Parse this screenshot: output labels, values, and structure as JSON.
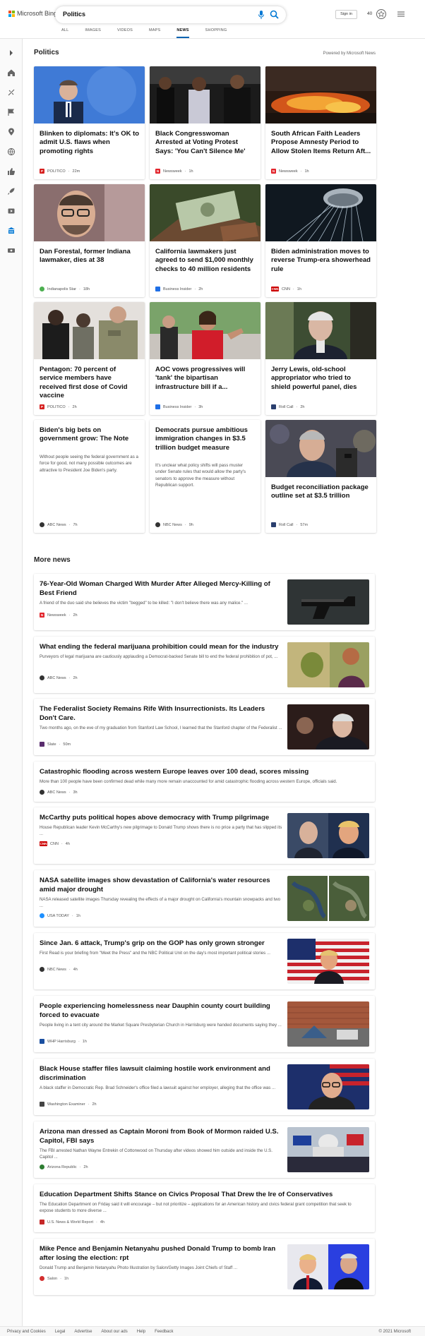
{
  "header": {
    "brand": "Microsoft Bing",
    "query": "Politics",
    "tabs": [
      {
        "label": "ALL"
      },
      {
        "label": "IMAGES"
      },
      {
        "label": "VIDEOS"
      },
      {
        "label": "MAPS"
      },
      {
        "label": "NEWS",
        "active": true
      },
      {
        "label": "SHOPPING"
      }
    ],
    "signin": "Sign in",
    "points": "40"
  },
  "politics": {
    "title": "Politics",
    "powered": "Powered by Microsoft News",
    "cards": [
      {
        "title": "Blinken to diplomats: It’s OK to admit U.S. flaws when promoting rights",
        "source": "POLITICO",
        "time": "22m",
        "logo": "P",
        "logo_color": "#d6201f",
        "img": "blinken"
      },
      {
        "title": "Black Congresswoman Arrested at Voting Protest Says: 'You Can't Silence Me'",
        "source": "Newsweek",
        "time": "1h",
        "logo": "N",
        "logo_color": "#e2252c",
        "img": "arrest"
      },
      {
        "title": "South African Faith Leaders Propose Amnesty Period to Allow Stolen Items Return Aft...",
        "source": "Newsweek",
        "time": "1h",
        "logo": "N",
        "logo_color": "#e2252c",
        "img": "fire"
      },
      {
        "title": "Dan Forestal, former Indiana lawmaker, dies at 38",
        "source": "Indianapolis Star",
        "time": "18h",
        "logo": "",
        "logo_color": "#4caf50",
        "img": "forestal"
      },
      {
        "title": "California lawmakers just agreed to send $1,000 monthly checks to 40 million residents",
        "source": "Business Insider",
        "time": "2h",
        "logo": "",
        "logo_color": "#1f6fe6",
        "img": "money"
      },
      {
        "title": "Biden administration moves to reverse Trump-era showerhead rule",
        "source": "CNN",
        "time": "1h",
        "logo": "CNN",
        "logo_color": "#cc0000",
        "img": "shower"
      },
      {
        "title": "Pentagon: 70 percent of service members have received first dose of Covid vaccine",
        "source": "POLITICO",
        "time": "2h",
        "logo": "P",
        "logo_color": "#d6201f",
        "img": "vaccine"
      },
      {
        "title": "AOC vows progressives will 'tank' the bipartisan infrastructure bill if a...",
        "source": "Business Insider",
        "time": "3h",
        "logo": "",
        "logo_color": "#1f6fe6",
        "img": "aoc"
      },
      {
        "title": "Jerry Lewis, old-school appropriator who tried to shield powerful panel, dies",
        "source": "Roll Call",
        "time": "2h",
        "logo": "",
        "logo_color": "#2a3f6e",
        "img": "lewis"
      },
      {
        "title": "Biden's big bets on government grow: The Note",
        "desc": "Without people seeing the federal government as a force for good, not many possible outcomes are attractive to President Joe Biden's party.",
        "source": "ABC News",
        "time": "7h",
        "logo": "",
        "logo_color": "#333",
        "img": ""
      },
      {
        "title": "Democrats pursue ambitious immigration changes in $3.5 trillion budget measure",
        "desc": "It's unclear what policy shifts will pass muster under Senate rules that would allow the party's senators to approve the measure without Republican support.",
        "source": "NBC News",
        "time": "9h",
        "logo": "",
        "logo_color": "#333",
        "img": ""
      },
      {
        "title": "Budget reconciliation package outline set at $3.5 trillion",
        "source": "Roll Call",
        "time": "57m",
        "logo": "",
        "logo_color": "#2a3f6e",
        "img": "manchin"
      }
    ]
  },
  "more": {
    "title": "More news",
    "items": [
      {
        "title": "76-Year-Old Woman Charged With Murder After Alleged Mercy-Killing of Best Friend",
        "desc": "A friend of the duo said she believes the victim \"begged\" to be killed: \"I don't believe there was any malice.\" ...",
        "source": "Newsweek",
        "time": "2h",
        "logo": "N",
        "logo_color": "#e2252c",
        "img": "gun"
      },
      {
        "title": "What ending the federal marijuana prohibition could mean for the industry",
        "desc": "Purveyors of legal marijuana are cautiously applauding a Democrat-backed Senate bill to end the federal prohibition of pot, ...",
        "source": "ABC News",
        "time": "2h",
        "logo": "",
        "logo_color": "#333",
        "img": "weed"
      },
      {
        "title": "The Federalist Society Remains Rife With Insurrectionists. Its Leaders Don't Care.",
        "desc": "Two months ago, on the eve of my graduation from Stanford Law School, I learned that the Stanford chapter of the Federalist ...",
        "source": "Slate",
        "time": "50m",
        "logo": "",
        "logo_color": "#5a2d6e",
        "img": "fedsoc"
      },
      {
        "title": "Catastrophic flooding across western Europe leaves over 100 dead, scores missing",
        "desc": "More than 100 people have been confirmed dead while many more remain unaccounted for amid catastrophic flooding across western Europe, officials said.",
        "source": "ABC News",
        "time": "3h",
        "logo": "",
        "logo_color": "#333",
        "img": ""
      },
      {
        "title": "McCarthy puts political hopes above democracy with Trump pilgrimage",
        "desc": "House Republican leader Kevin McCarthy's new pilgrimage to Donald Trump shows there is no price a party that has slipped its ...",
        "source": "CNN",
        "time": "4h",
        "logo": "CNN",
        "logo_color": "#cc0000",
        "img": "mccarthy"
      },
      {
        "title": "NASA satellite images show devastation of California's water resources amid major drought",
        "desc": "NASA released satellite images Thursday revealing the effects of a major drought on California's mountain snowpacks and two ...",
        "source": "USA TODAY",
        "time": "1h",
        "logo": "",
        "logo_color": "#1e90ff",
        "img": "sat"
      },
      {
        "title": "Since Jan. 6 attack, Trump's grip on the GOP has only grown stronger",
        "desc": "First Read is your briefing from \"Meet the Press\" and the NBC Political Unit on the day's most important political stories ...",
        "source": "NBC News",
        "time": "4h",
        "logo": "",
        "logo_color": "#333",
        "img": "trump"
      },
      {
        "title": "People experiencing homelessness near Dauphin county court building forced to evacuate",
        "desc": "People living in a tent city around the Market Square Presbyterian Church in Harrisburg were handed documents saying they ...",
        "source": "WHP Harrisburg",
        "time": "1h",
        "logo": "",
        "logo_color": "#1a4fa0",
        "img": "tent"
      },
      {
        "title": "Black House staffer files lawsuit claiming hostile work environment and discrimination",
        "desc": "A black staffer in Democratic Rep. Brad Schneider's office filed a lawsuit against her employer, alleging that the office was ...",
        "source": "Washington Examiner",
        "time": "2h",
        "logo": "",
        "logo_color": "#444",
        "img": "schneider"
      },
      {
        "title": "Arizona man dressed as Captain Moroni from Book of Mormon raided U.S. Capitol, FBI says",
        "desc": "The FBI arrested Nathan Wayne Entrekin of Cottonwood on Thursday after videos showed him outside and inside the U.S. Capitol ...",
        "source": "Arizona Republic",
        "time": "2h",
        "logo": "",
        "logo_color": "#2e7d32",
        "img": "capitol"
      },
      {
        "title": "Education Department Shifts Stance on Civics Proposal That Drew the Ire of Conservatives",
        "desc": "The Education Department on Friday said it will encourage – but not prioritize – applications for an American history and civics federal grant competition that seek to expose students to more diverse ...",
        "source": "U.S. News & World Report",
        "time": "4h",
        "logo": "",
        "logo_color": "#c62828",
        "img": ""
      },
      {
        "title": "Mike Pence and Benjamin Netanyahu pushed Donald Trump to bomb Iran after losing the election: rpt",
        "desc": "Donald Trump and Benjamin Netanyahu Photo Illustration by Salon/Getty Images Joint Chiefs of Staff ...",
        "source": "Salon",
        "time": "1h",
        "logo": "",
        "logo_color": "#d32f2f",
        "img": "pence"
      }
    ]
  },
  "footer": {
    "links": [
      "Privacy and Cookies",
      "Legal",
      "Advertise",
      "About our ads",
      "Help",
      "Feedback"
    ],
    "copyright": "© 2021 Microsoft"
  }
}
